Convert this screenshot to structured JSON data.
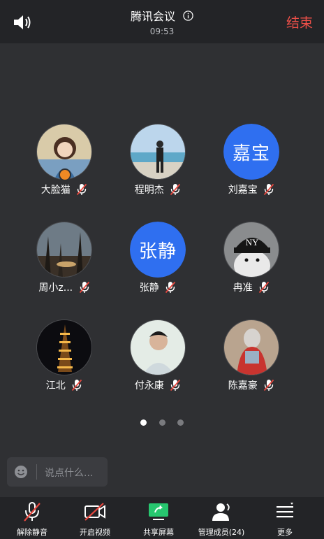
{
  "header": {
    "title": "腾讯会议",
    "time": "09:53",
    "end_label": "结束"
  },
  "participants": [
    {
      "name": "大脸猫",
      "avatar": "photo"
    },
    {
      "name": "程明杰",
      "avatar": "photo"
    },
    {
      "name": "刘嘉宝",
      "avatar_text": "嘉宝"
    },
    {
      "name": "周小z...",
      "avatar": "photo"
    },
    {
      "name": "张静",
      "avatar_text": "张静"
    },
    {
      "name": "冉准",
      "avatar": "photo"
    },
    {
      "name": "江北",
      "avatar": "photo"
    },
    {
      "name": "付永康",
      "avatar": "photo"
    },
    {
      "name": "陈嘉豪",
      "avatar": "photo"
    }
  ],
  "pager": {
    "pages": 3,
    "current": 1
  },
  "chat": {
    "placeholder": "说点什么..."
  },
  "toolbar": {
    "unmute": "解除静音",
    "video": "开启视频",
    "share": "共享屏幕",
    "members": "管理成员(24)",
    "more": "更多"
  },
  "colors": {
    "accent_blue": "#2f6ff0",
    "end_red": "#f05049",
    "share_green": "#27c76f",
    "mute_red": "#e8483f"
  }
}
